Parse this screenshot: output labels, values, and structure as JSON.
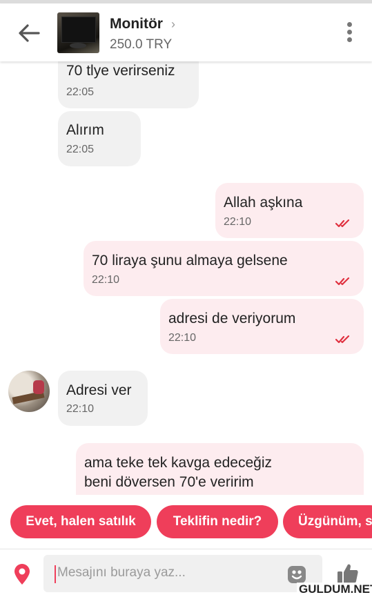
{
  "header": {
    "title": "Monitör",
    "price": "250.0 TRY"
  },
  "messages": [
    {
      "dir": "in",
      "text": "70 tlye verirseniz",
      "time": "22:05"
    },
    {
      "dir": "in",
      "text": "Alırım",
      "time": "22:05"
    },
    {
      "dir": "out",
      "text": "Allah aşkına",
      "time": "22:10"
    },
    {
      "dir": "out",
      "text": "70 liraya şunu almaya gelsene",
      "time": "22:10"
    },
    {
      "dir": "out",
      "text": "adresi de veriyorum",
      "time": "22:10"
    },
    {
      "dir": "in",
      "text": "Adresi ver",
      "time": "22:10"
    },
    {
      "dir": "out",
      "lines": [
        "ama teke tek kavga edeceğiz",
        "beni döversen 70'e veririm"
      ]
    }
  ],
  "quick_replies": [
    "Evet, halen satılık",
    "Teklifin nedir?",
    "Üzgünüm, s"
  ],
  "composer": {
    "placeholder": "Mesajını buraya yaz..."
  },
  "watermark": "GULDUM.NET",
  "colors": {
    "accent": "#ef3e5a",
    "incoming_bubble": "#f1f1f1",
    "outgoing_bubble": "#fdecef",
    "tick": "#e0303f"
  },
  "icons": [
    "back-arrow-icon",
    "chevron-right-icon",
    "more-vertical-icon",
    "double-check-icon",
    "location-pin-icon",
    "sticker-icon",
    "thumbs-up-icon"
  ]
}
